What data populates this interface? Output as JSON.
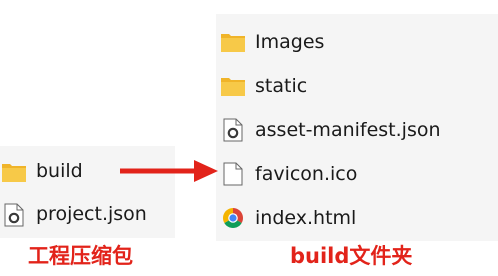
{
  "zip_archive": {
    "files": [
      {
        "name": "build",
        "icon": "folder-icon"
      },
      {
        "name": "project.json",
        "icon": "json-file-icon"
      }
    ],
    "caption": "工程压缩包"
  },
  "build_folder": {
    "files": [
      {
        "name": "Images",
        "icon": "folder-icon"
      },
      {
        "name": "static",
        "icon": "folder-icon"
      },
      {
        "name": "asset-manifest.json",
        "icon": "json-file-icon"
      },
      {
        "name": "favicon.ico",
        "icon": "blank-file-icon"
      },
      {
        "name": "index.html",
        "icon": "chrome-html-icon"
      }
    ],
    "caption": "build文件夹"
  },
  "colors": {
    "folder": "#f7c948",
    "folder_tab": "#f0b429",
    "arrow": "#e2231a",
    "caption": "#e2231a",
    "panel_bg": "#f5f5f5"
  }
}
